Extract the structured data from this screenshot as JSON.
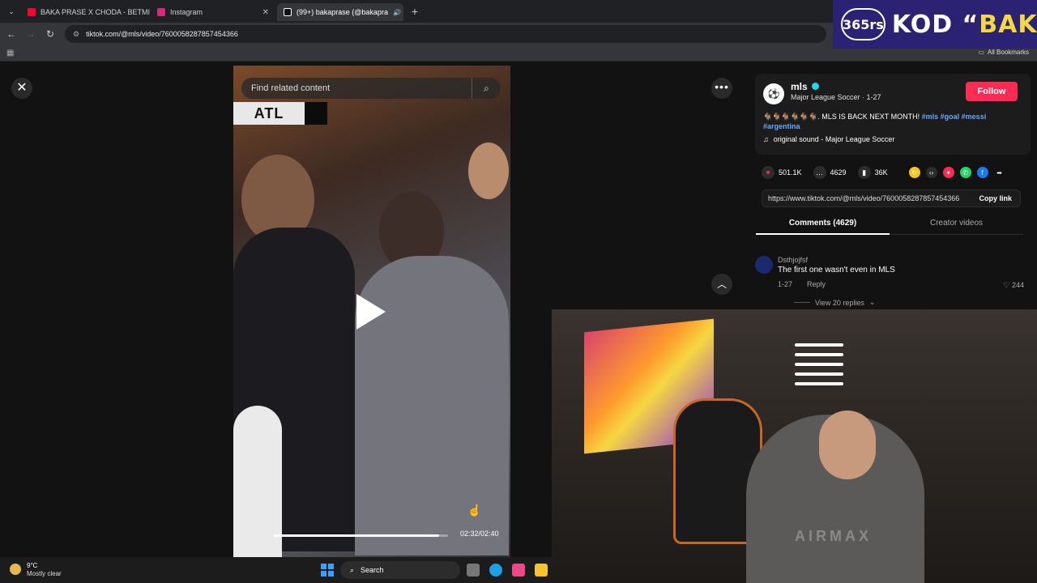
{
  "browser": {
    "tabs": [
      {
        "label": "BAKA PRASE X CHODA - BETMI",
        "favicon_color": "#ff0033",
        "active": false
      },
      {
        "label": "Instagram",
        "favicon_color": "#d62976",
        "active": false
      },
      {
        "label": "(99+) bakaprase (@bakapra",
        "favicon_color": "#111111",
        "active": true
      }
    ],
    "url": "tiktok.com/@mls/video/7600058287857454366",
    "all_bookmarks": "All Bookmarks"
  },
  "promo": {
    "logo_text": "365rs",
    "code_prefix": "KOD “",
    "code_value": "BAKA",
    "code_suffix": "”"
  },
  "video": {
    "search_placeholder": "Find related content",
    "score_label": "ATL",
    "progress": 0.95,
    "time": "02:32/02:40"
  },
  "author": {
    "logo": "⚽",
    "name": "mls",
    "subtitle": "Major League Soccer · 1-27",
    "follow_label": "Follow",
    "caption_pre": "🐐🐐🐐🐐🐐🐐. MLS IS BACK NEXT MONTH!",
    "tags": [
      "#mls",
      "#goal",
      "#messi",
      "#argentina"
    ],
    "sound": "original sound - Major League Soccer"
  },
  "actions": {
    "likes": "501.1K",
    "comments": "4629",
    "saves": "36K",
    "share_colors": [
      "#f5c518",
      "#2c2c2c",
      "#fe2c55",
      "#25d366",
      "#1877f2",
      "#2c2c2c"
    ]
  },
  "link": {
    "url": "https://www.tiktok.com/@mls/video/7600058287857454366",
    "copy_label": "Copy link"
  },
  "tabs": {
    "comments": "Comments (4629)",
    "creator": "Creator videos"
  },
  "comment": {
    "user": "Dsthjojfsf",
    "text": "The first one wasn't even in MLS",
    "date": "1-27",
    "reply": "Reply",
    "likes": "244",
    "view_replies": "View 20 replies"
  },
  "webcam": {
    "shirt_text": "AIRMAX"
  },
  "taskbar": {
    "temp": "9°C",
    "condition": "Mostly clear",
    "search": "Search"
  }
}
